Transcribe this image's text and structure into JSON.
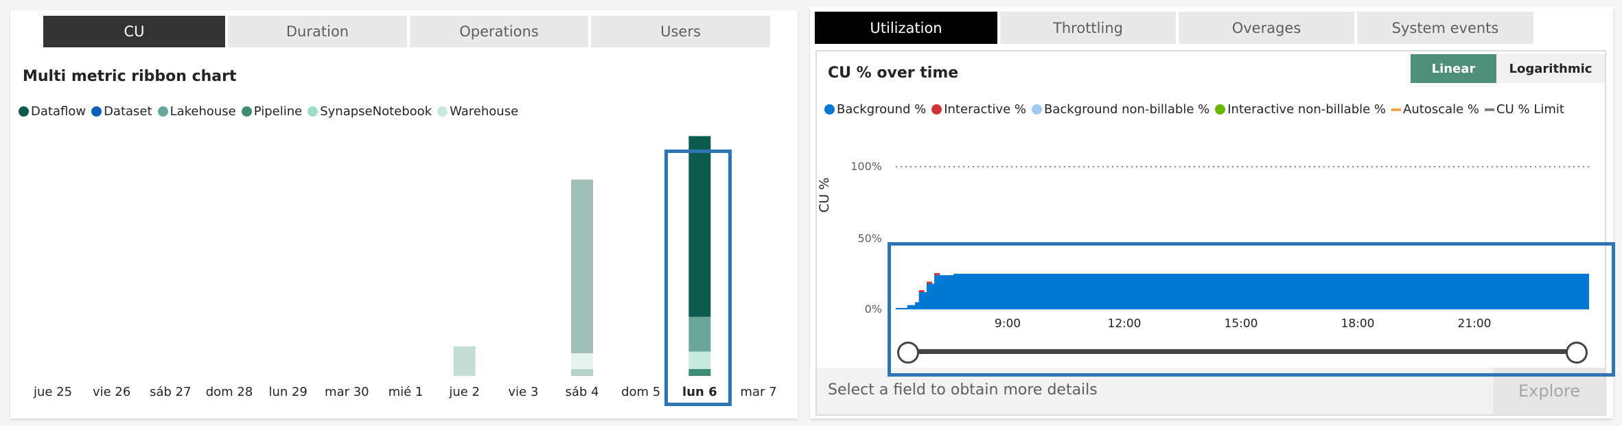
{
  "left_panel": {
    "tabs": [
      {
        "label": "CU",
        "active": true
      },
      {
        "label": "Duration",
        "active": false
      },
      {
        "label": "Operations",
        "active": false
      },
      {
        "label": "Users",
        "active": false
      }
    ],
    "title": "Multi metric ribbon chart",
    "legend": [
      {
        "label": "Dataflow",
        "color": "#0b5c4e"
      },
      {
        "label": "Dataset",
        "color": "#0e5fb8"
      },
      {
        "label": "Lakehouse",
        "color": "#6aa699"
      },
      {
        "label": "Pipeline",
        "color": "#3f8b76"
      },
      {
        "label": "SynapseNotebook",
        "color": "#9fdcc9"
      },
      {
        "label": "Warehouse",
        "color": "#c8e7de"
      }
    ],
    "selected_category": "lun 6"
  },
  "right_panel": {
    "tabs": [
      {
        "label": "Utilization",
        "active": true
      },
      {
        "label": "Throttling",
        "active": false
      },
      {
        "label": "Overages",
        "active": false
      },
      {
        "label": "System events",
        "active": false
      }
    ],
    "title": "CU % over time",
    "scale_buttons": {
      "linear": "Linear",
      "logarithmic": "Logarithmic",
      "selected": "Linear"
    },
    "legend": [
      {
        "label": "Background %",
        "color": "#0078d4",
        "shape": "dot"
      },
      {
        "label": "Interactive %",
        "color": "#d13438",
        "shape": "dot"
      },
      {
        "label": "Background non-billable %",
        "color": "#9fc9ee",
        "shape": "dot"
      },
      {
        "label": "Interactive non-billable %",
        "color": "#6bb700",
        "shape": "dot"
      },
      {
        "label": "Autoscale %",
        "color": "#f7a74a",
        "shape": "dash"
      },
      {
        "label": "CU % Limit",
        "color": "#808080",
        "shape": "dash"
      }
    ],
    "footer_text": "Select a field to obtain more details",
    "explore_label": "Explore"
  },
  "chart_data": [
    {
      "type": "bar",
      "title": "Multi metric ribbon chart",
      "stacked": true,
      "categories": [
        "jue 25",
        "vie 26",
        "sáb 27",
        "dom 28",
        "lun 29",
        "mar 30",
        "mié 1",
        "jue 2",
        "vie 3",
        "sáb 4",
        "dom 5",
        "lun 6",
        "mar 7"
      ],
      "series": [
        {
          "name": "Dataflow",
          "values": [
            0,
            0,
            0,
            0,
            0,
            0,
            0,
            0,
            0,
            0,
            0,
            52,
            0
          ]
        },
        {
          "name": "Dataset",
          "values": [
            0,
            0,
            0,
            0,
            0,
            0,
            0,
            0,
            0,
            0,
            0,
            0,
            0
          ]
        },
        {
          "name": "Lakehouse",
          "values": [
            0,
            0,
            0,
            0,
            0,
            0,
            0,
            0,
            0,
            50,
            0,
            10,
            0
          ]
        },
        {
          "name": "Pipeline",
          "values": [
            0,
            0,
            0,
            0,
            0,
            0,
            0,
            0,
            0,
            2,
            0,
            2,
            0
          ]
        },
        {
          "name": "SynapseNotebook",
          "values": [
            0,
            0,
            0,
            0,
            0,
            0,
            0,
            0,
            0,
            0,
            0,
            5,
            0
          ]
        },
        {
          "name": "Warehouse",
          "values": [
            0,
            0,
            0,
            0,
            0,
            0,
            0,
            8.5,
            0,
            4.5,
            0,
            0,
            0
          ]
        }
      ],
      "ylim": [
        0,
        75
      ],
      "xlabel": "",
      "ylabel": "",
      "legend_position": "top-left",
      "grid": false
    },
    {
      "type": "area",
      "title": "CU % over time",
      "ylabel": "CU %",
      "xlabel": "",
      "y_ticks": [
        "0%",
        "50%",
        "100%"
      ],
      "x_ticks": [
        "9:00",
        "12:00",
        "15:00",
        "18:00",
        "21:00"
      ],
      "ylim": [
        0,
        100
      ],
      "x_range_hours": [
        6.0,
        24.0
      ],
      "series": [
        {
          "name": "Background %",
          "x_hours": [
            6.0,
            6.3,
            6.5,
            6.6,
            6.8,
            7.0,
            7.5,
            24.0
          ],
          "values": [
            1,
            3,
            5,
            12,
            18,
            24,
            25,
            25
          ]
        },
        {
          "name": "Interactive %",
          "x_hours": [
            6.6,
            6.8,
            7.0
          ],
          "values": [
            0.8,
            0.8,
            0.5
          ]
        },
        {
          "name": "CU % Limit",
          "constant": 100
        }
      ],
      "legend_position": "top-left",
      "grid": false
    }
  ]
}
